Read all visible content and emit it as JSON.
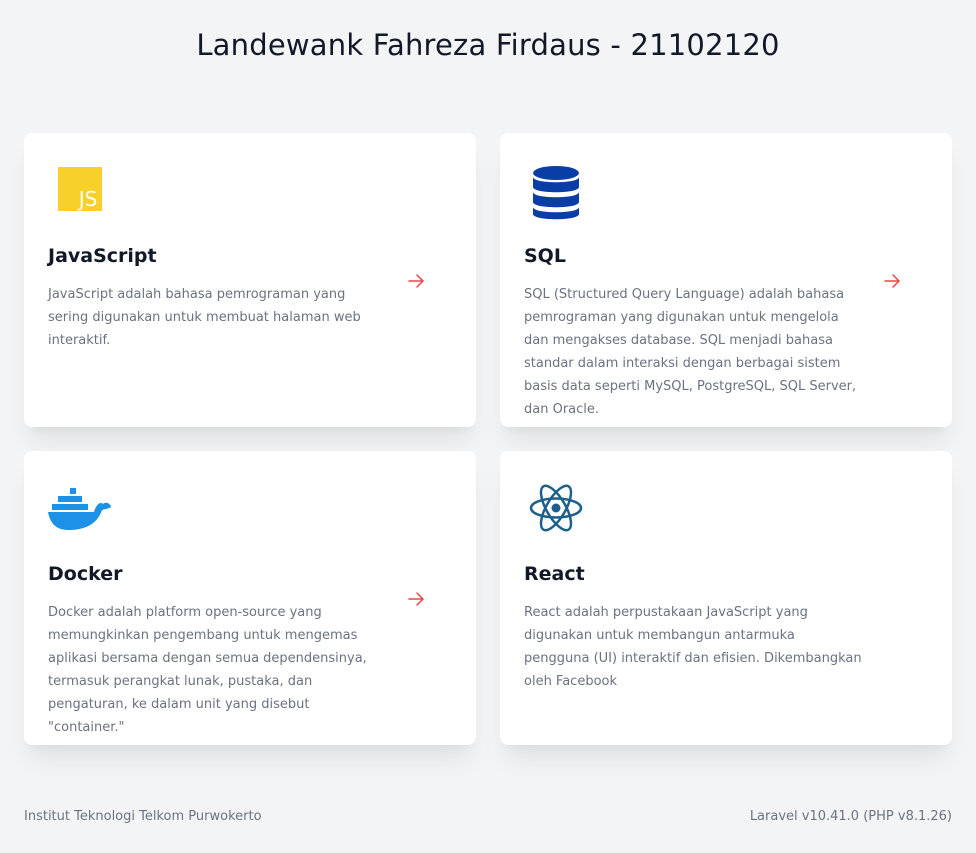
{
  "header": {
    "title": "Landewank Fahreza Firdaus - 21102120"
  },
  "cards": [
    {
      "title": "JavaScript",
      "description": "JavaScript adalah bahasa pemrograman yang sering digunakan untuk membuat halaman web interaktif.",
      "icon": "javascript-logo-icon",
      "has_arrow": true
    },
    {
      "title": "SQL",
      "description": "SQL (Structured Query Language) adalah bahasa pemrograman yang digunakan untuk mengelola dan mengakses database. SQL menjadi bahasa standar dalam interaksi dengan berbagai sistem basis data seperti MySQL, PostgreSQL, SQL Server, dan Oracle.",
      "icon": "database-icon",
      "has_arrow": true
    },
    {
      "title": "Docker",
      "description": "Docker adalah platform open-source yang memungkinkan pengembang untuk mengemas aplikasi bersama dengan semua dependensinya, termasuk perangkat lunak, pustaka, dan pengaturan, ke dalam unit yang disebut \"container.\"",
      "icon": "docker-whale-icon",
      "has_arrow": true
    },
    {
      "title": "React",
      "description": "React adalah perpustakaan JavaScript yang digunakan untuk membangun antarmuka pengguna (UI) interaktif dan efisien. Dikembangkan oleh Facebook",
      "icon": "react-atom-icon",
      "has_arrow": false
    }
  ],
  "footer": {
    "left": "Institut Teknologi Telkom Purwokerto",
    "right": "Laravel v10.41.0 (PHP v8.1.26)"
  },
  "colors": {
    "background": "#f3f4f6",
    "card": "#ffffff",
    "arrow": "#ef4444",
    "javascript": "#f7d02c",
    "sql": "#0a3ea6",
    "docker": "#1d91e6",
    "react": "#1f5f8b"
  }
}
